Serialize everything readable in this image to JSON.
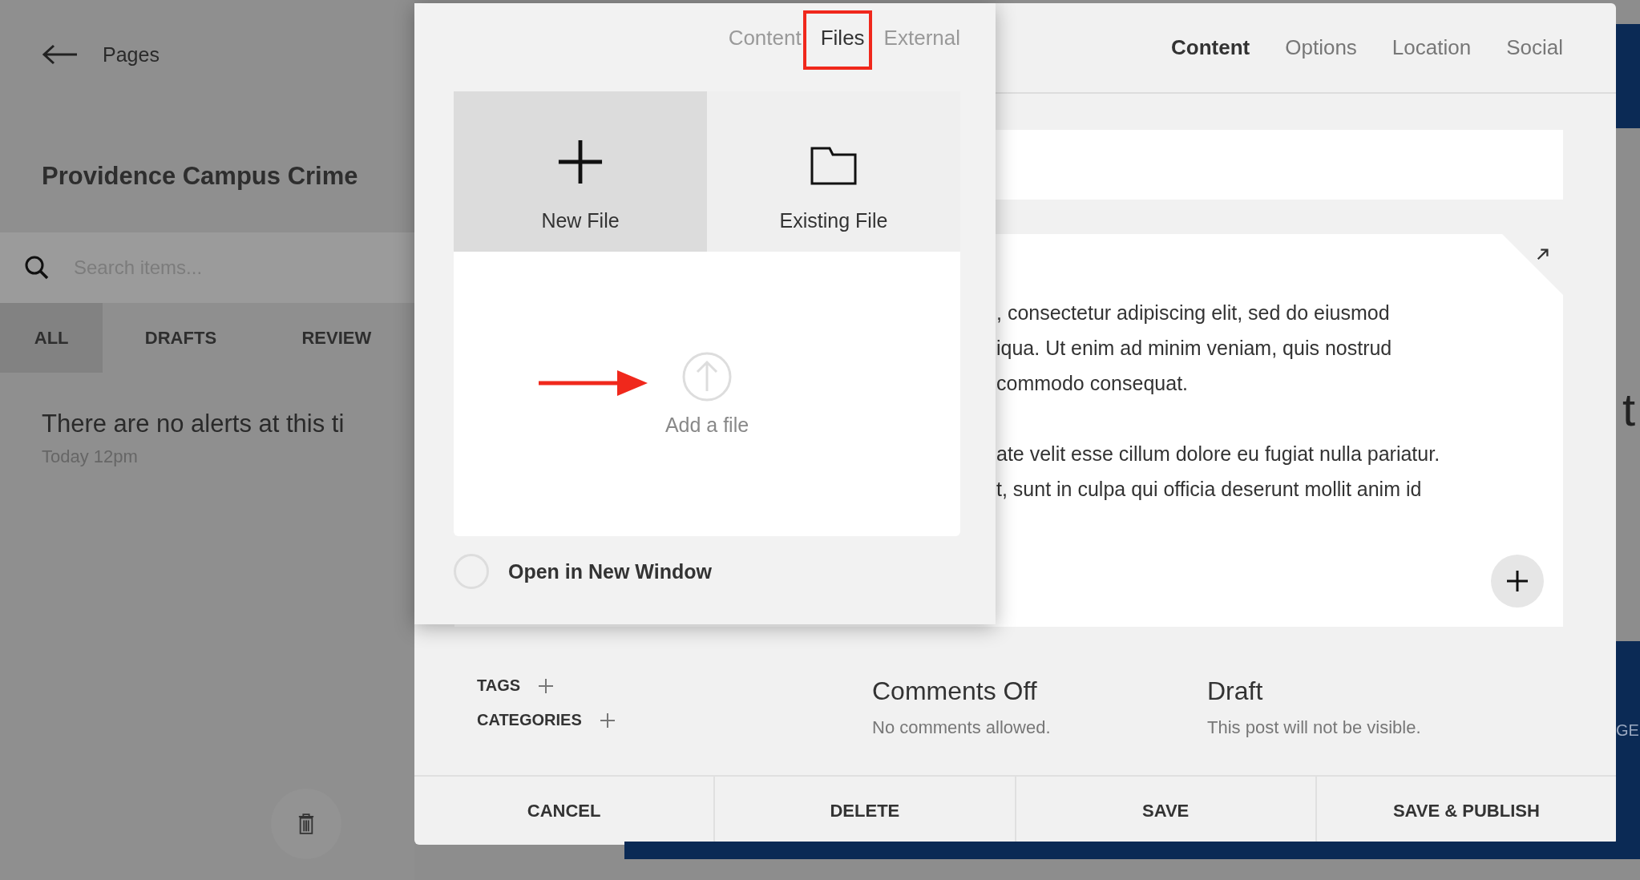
{
  "sidebar": {
    "back_label": "Pages",
    "title": "Providence Campus Crime",
    "search": {
      "placeholder": "Search items..."
    },
    "tabs": [
      {
        "label": "ALL",
        "selected": true
      },
      {
        "label": "DRAFTS",
        "selected": false
      },
      {
        "label": "REVIEW",
        "selected": false
      }
    ],
    "items": [
      {
        "title": "There are no alerts at this ti",
        "time": "Today 12pm"
      }
    ]
  },
  "editor": {
    "tabs": [
      {
        "label": "Content",
        "selected": true
      },
      {
        "label": "Options",
        "selected": false
      },
      {
        "label": "Location",
        "selected": false
      },
      {
        "label": "Social",
        "selected": false
      }
    ],
    "paragraphs": [
      [
        ", consectetur adipiscing elit, sed do eiusmod",
        "iqua. Ut enim ad minim veniam, quis nostrud",
        "commodo consequat."
      ],
      [
        "ate velit esse cillum dolore eu fugiat nulla pariatur.",
        "t, sunt in culpa qui officia deserunt mollit anim id"
      ]
    ],
    "tags_label": "TAGS",
    "categories_label": "CATEGORIES",
    "comments": {
      "title": "Comments Off",
      "note": "No comments allowed."
    },
    "status": {
      "title": "Draft",
      "note": "This post will not be visible."
    },
    "buttons": [
      "CANCEL",
      "DELETE",
      "SAVE",
      "SAVE & PUBLISH"
    ]
  },
  "link_popup": {
    "tabs": [
      {
        "label": "Content",
        "selected": false
      },
      {
        "label": "Files",
        "selected": true
      },
      {
        "label": "External",
        "selected": false
      }
    ],
    "sources": [
      {
        "label": "New File",
        "kind": "new",
        "selected": true
      },
      {
        "label": "Existing File",
        "kind": "existing",
        "selected": false
      }
    ],
    "dropzone_label": "Add a file",
    "open_new_window": {
      "label": "Open in New Window",
      "checked": false
    }
  },
  "background_fragments": [
    "t",
    "GE"
  ]
}
